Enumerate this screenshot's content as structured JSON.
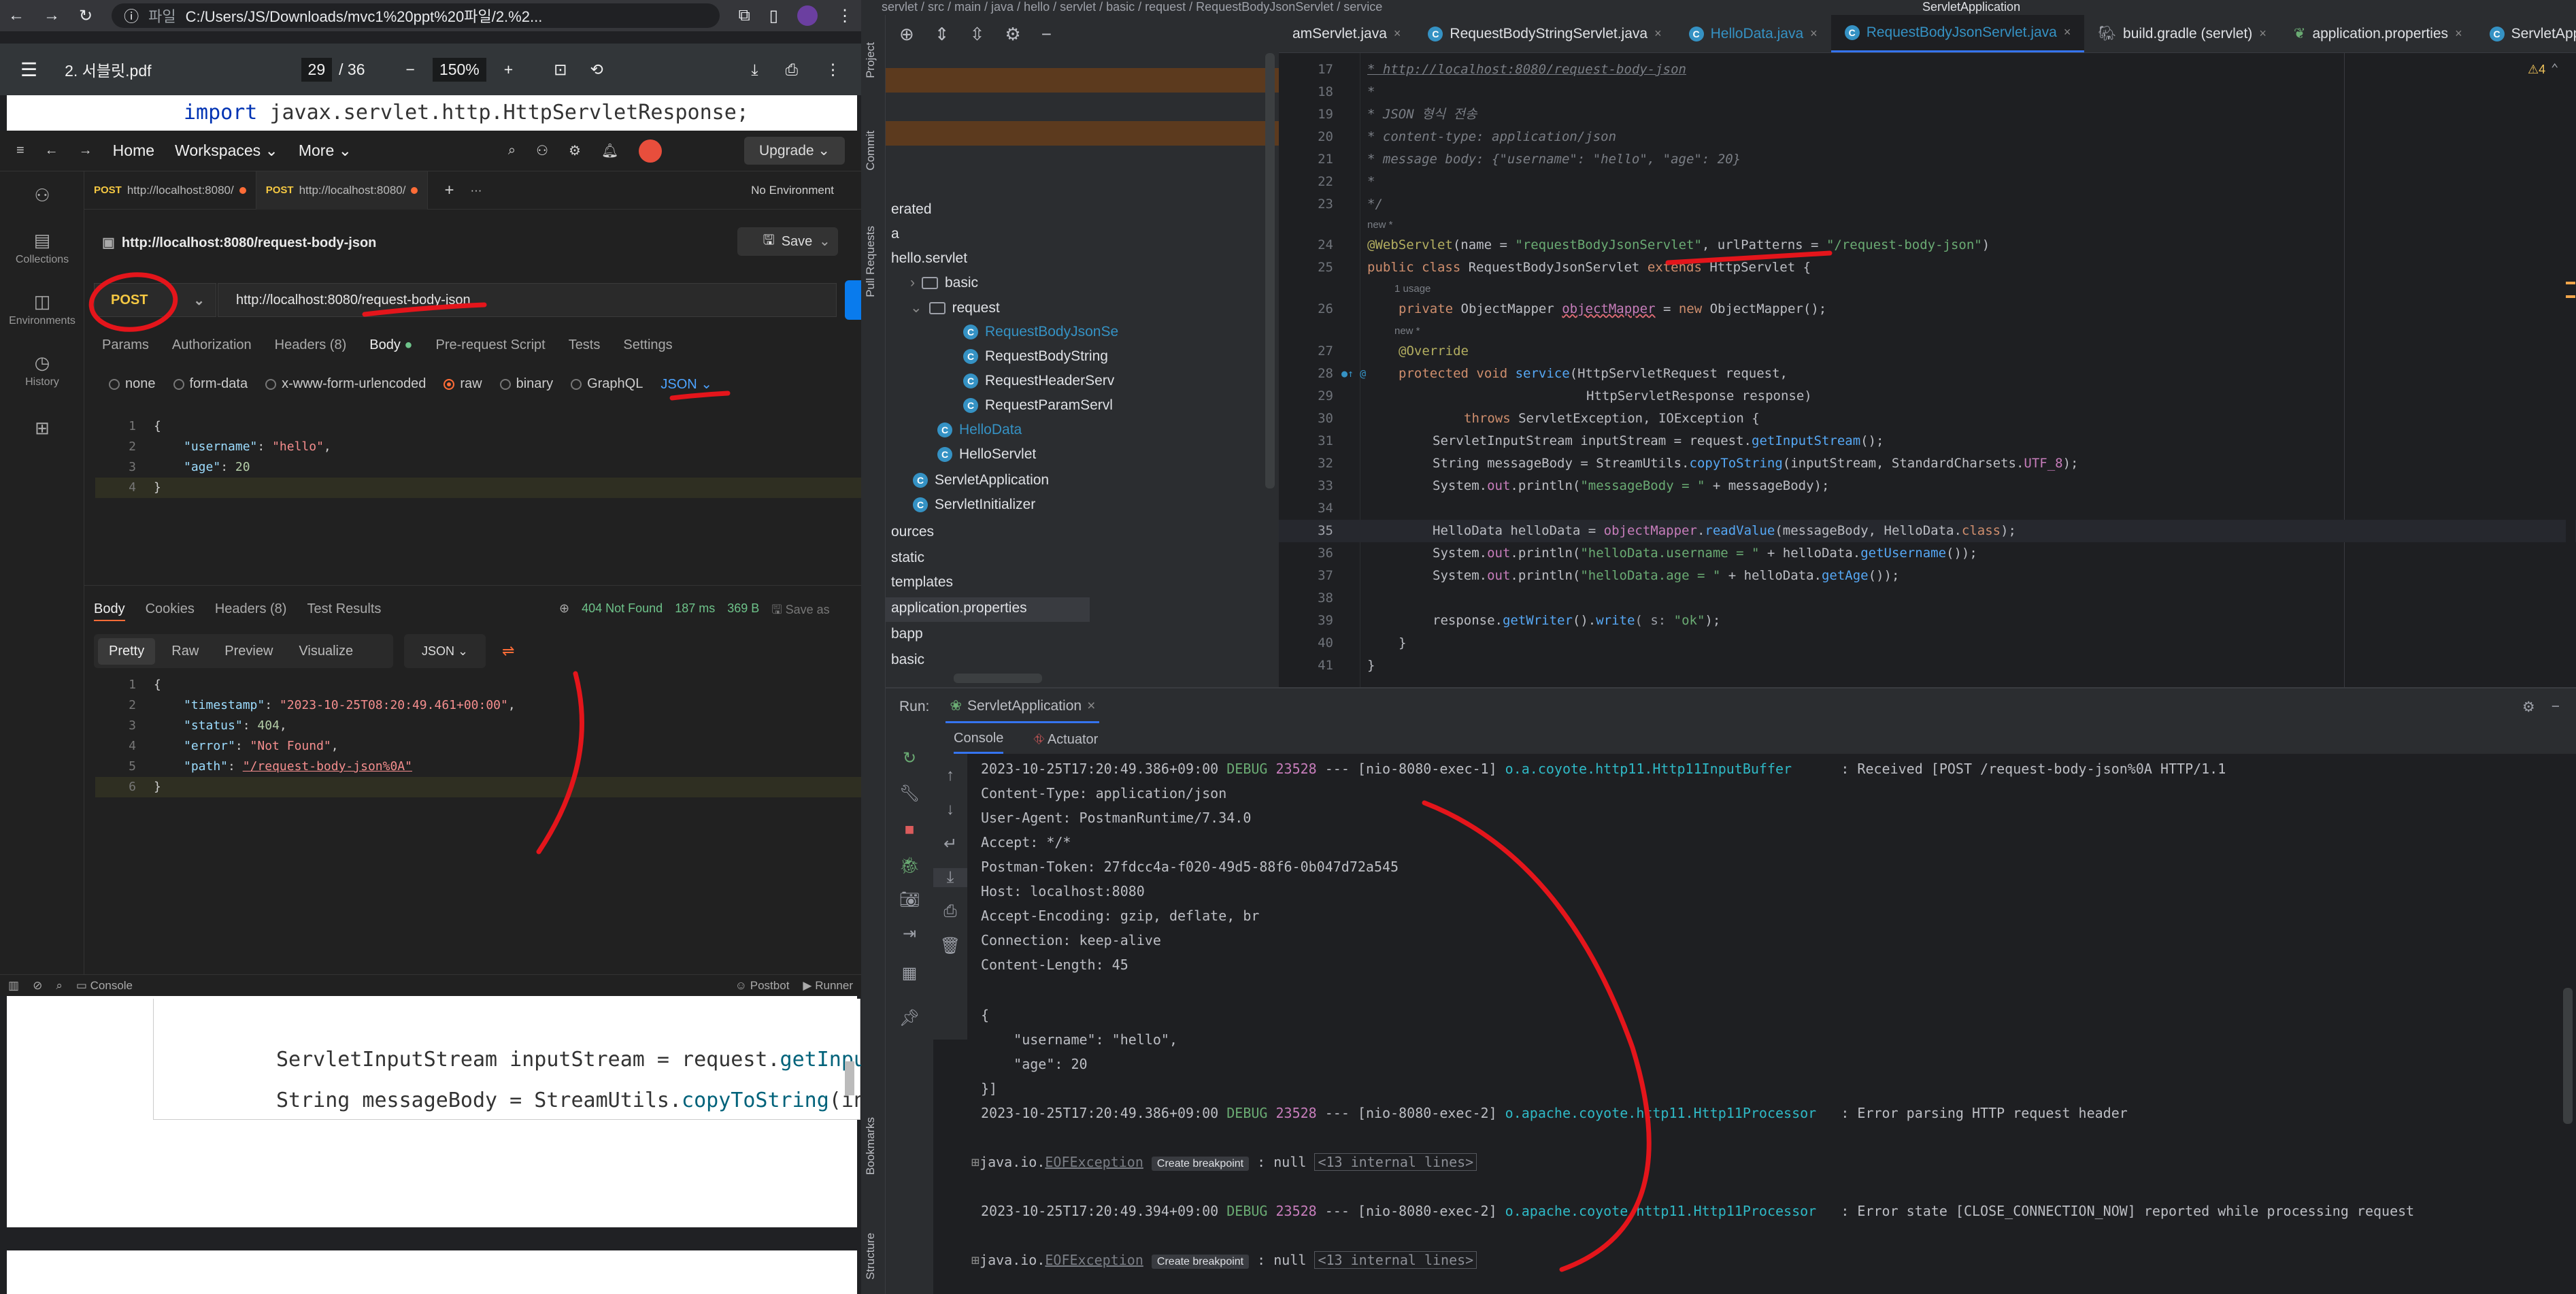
{
  "browser": {
    "address_prefix": "파일",
    "address": "C:/Users/JS/Downloads/mvc1%20ppt%20파일/2.%2..."
  },
  "pdf": {
    "filename": "2. 서블릿.pdf",
    "page_current": "29",
    "page_total": "/ 36",
    "zoom": "150%",
    "top_code_keyword": "import",
    "top_code_rest": " javax.servlet.http.HttpServletResponse;",
    "lower_line1_pre": "ServletInputStream inputStream = request.",
    "lower_line1_fn": "getInput",
    "lower_line2_pre": "String messageBody = StreamUtils.",
    "lower_line2_fn": "copyToString",
    "lower_line2_post": "(inp"
  },
  "postman": {
    "nav": {
      "home": "Home",
      "workspaces": "Workspaces",
      "more": "More",
      "upgrade": "Upgrade"
    },
    "sidebar": [
      {
        "icon": "person-icon",
        "label": ""
      },
      {
        "icon": "collections-icon",
        "label": "Collections"
      },
      {
        "icon": "environments-icon",
        "label": "Environments"
      },
      {
        "icon": "history-icon",
        "label": "History"
      },
      {
        "icon": "apps-icon",
        "label": ""
      }
    ],
    "tabs": [
      {
        "method": "POST",
        "url": "http://localhost:8080/"
      },
      {
        "method": "POST",
        "url": "http://localhost:8080/"
      }
    ],
    "environment": "No Environment",
    "request_title": "http://localhost:8080/request-body-json",
    "save_label": "Save",
    "method": "POST",
    "url": "http://localhost:8080/request-body-json",
    "req_subtabs": [
      "Params",
      "Authorization",
      "Headers (8)",
      "Body",
      "Pre-request Script",
      "Tests",
      "Settings"
    ],
    "body_types": [
      "none",
      "form-data",
      "x-www-form-urlencoded",
      "raw",
      "binary",
      "GraphQL"
    ],
    "body_format": "JSON",
    "request_body": [
      {
        "n": "1",
        "text": "{"
      },
      {
        "n": "2",
        "key": "\"username\"",
        "val": "\"hello\"",
        "tail": ","
      },
      {
        "n": "3",
        "key": "\"age\"",
        "num": "20"
      },
      {
        "n": "4",
        "text": "}"
      }
    ],
    "resp_tabs": [
      "Body",
      "Cookies",
      "Headers (8)",
      "Test Results"
    ],
    "resp_status": "404 Not Found",
    "resp_time": "187 ms",
    "resp_size": "369 B",
    "resp_save": "Save as",
    "resp_views": [
      "Pretty",
      "Raw",
      "Preview",
      "Visualize"
    ],
    "resp_format": "JSON",
    "response_body": [
      {
        "n": "1",
        "text": "{"
      },
      {
        "n": "2",
        "key": "\"timestamp\"",
        "val": "\"2023-10-25T08:20:49.461+00:00\"",
        "tail": ","
      },
      {
        "n": "3",
        "key": "\"status\"",
        "num": "404",
        "tail": ","
      },
      {
        "n": "4",
        "key": "\"error\"",
        "val": "\"Not Found\"",
        "tail": ","
      },
      {
        "n": "5",
        "key": "\"path\"",
        "val": "\"/request-body-json%0A\""
      },
      {
        "n": "6",
        "text": "}"
      }
    ],
    "footer": {
      "console": "Console",
      "postbot": "Postbot",
      "runner": "Runner"
    }
  },
  "ide": {
    "breadcrumb": "servlet  /  src  /  main  /  java  /  hello  /  servlet  /  basic  /  request  /  RequestBodyJsonServlet  /  service",
    "run_config": "ServletApplication",
    "side_labels": [
      "Project",
      "Commit",
      "Pull Requests",
      "Bookmarks",
      "Structure"
    ],
    "tree": [
      {
        "text": "erated",
        "kind": "text"
      },
      {
        "text": "a",
        "kind": "text"
      },
      {
        "text": "hello.servlet",
        "kind": "text"
      },
      {
        "text": "basic",
        "kind": "folder"
      },
      {
        "text": "request",
        "kind": "folder"
      },
      {
        "text": "RequestBodyJsonSe",
        "kind": "class",
        "selected": true
      },
      {
        "text": "RequestBodyString",
        "kind": "class"
      },
      {
        "text": "RequestHeaderServ",
        "kind": "class"
      },
      {
        "text": "RequestParamServl",
        "kind": "class"
      },
      {
        "text": "HelloData",
        "kind": "class"
      },
      {
        "text": "HelloServlet",
        "kind": "class"
      },
      {
        "text": "ServletApplication",
        "kind": "class"
      },
      {
        "text": "ServletInitializer",
        "kind": "class"
      },
      {
        "text": "ources",
        "kind": "text"
      },
      {
        "text": "static",
        "kind": "text"
      },
      {
        "text": "templates",
        "kind": "text"
      },
      {
        "text": "application.properties",
        "kind": "text",
        "selected": true
      },
      {
        "text": "bapp",
        "kind": "text"
      },
      {
        "text": "basic",
        "kind": "text"
      }
    ],
    "editor_tabs": [
      {
        "label": "amServlet.java",
        "active": false
      },
      {
        "label": "RequestBodyStringServlet.java",
        "active": false
      },
      {
        "label": "HelloData.java",
        "active": false
      },
      {
        "label": "RequestBodyJsonServlet.java",
        "active": true
      },
      {
        "label": "build.gradle (servlet)",
        "active": false
      },
      {
        "label": "application.properties",
        "active": false
      },
      {
        "label": "ServletApplication.java",
        "active": false
      }
    ],
    "warnings": "4",
    "code": {
      "l17": "17",
      "c17": "* http://localhost:8080/request-body-json",
      "l18": "18",
      "c18": "*",
      "l19": "19",
      "c19": "* JSON 형식 전송",
      "l20": "20",
      "c20": "* content-type: application/json",
      "l21": "21",
      "c21": "* message body: {\"username\": \"hello\", \"age\": 20}",
      "l22": "22",
      "c22": "*",
      "l23": "23",
      "c23": "*/",
      "hint_new1": "new *",
      "l24": "24",
      "c24_ann": "@WebServlet",
      "c24_a": "(name = ",
      "c24_s1": "\"requestBodyJsonServlet\"",
      "c24_b": ", urlPatterns = ",
      "c24_s2": "\"/request-body-json\"",
      "c24_c": ")",
      "l25": "25",
      "c25_kw": "public class ",
      "c25_a": "RequestBodyJsonServlet ",
      "c25_kw2": "extends ",
      "c25_b": "HttpServlet {",
      "hint_usage": "1 usage",
      "l26": "26",
      "c26_kw": "private ",
      "c26_a": "ObjectMapper ",
      "c26_f": "objectMapper",
      "c26_b": " = ",
      "c26_kw2": "new ",
      "c26_c": "ObjectMapper();",
      "hint_new2": "new *",
      "l27": "27",
      "c27": "@Override",
      "l28": "28",
      "c28_kw": "protected void ",
      "c28_m": "service",
      "c28_a": "(HttpServletRequest request,",
      "l29": "29",
      "c29": "HttpServletResponse response)",
      "l30": "30",
      "c30_kw": "throws ",
      "c30_a": "ServletException, IOException {",
      "l31": "31",
      "c31_a": "ServletInputStream inputStream = request.",
      "c31_m": "getInputStream",
      "c31_b": "();",
      "l32": "32",
      "c32_a": "String messageBody = StreamUtils.",
      "c32_m": "copyToString",
      "c32_b": "(inputStream, StandardCharsets.",
      "c32_f": "UTF_8",
      "c32_c": ");",
      "l33": "33",
      "c33_a": "System.",
      "c33_f": "out",
      "c33_b": ".println(",
      "c33_s": "\"messageBody = \"",
      "c33_c": " + messageBody);",
      "l34": "34",
      "l35": "35",
      "c35_a": "HelloData helloData = ",
      "c35_f": "objectMapper",
      "c35_b": ".",
      "c35_m": "readValue",
      "c35_c": "(messageBody, HelloData.",
      "c35_kw": "class",
      "c35_d": ");",
      "l36": "36",
      "c36_a": "System.",
      "c36_f": "out",
      "c36_b": ".println(",
      "c36_s": "\"helloData.username = \"",
      "c36_c": " + helloData.",
      "c36_m": "getUsername",
      "c36_d": "());",
      "l37": "37",
      "c37_a": "System.",
      "c37_f": "out",
      "c37_b": ".println(",
      "c37_s": "\"helloData.age = \"",
      "c37_c": " + helloData.",
      "c37_m": "getAge",
      "c37_d": "());",
      "l38": "38",
      "l39": "39",
      "c39_a": "response.",
      "c39_m": "getWriter",
      "c39_b": "().",
      "c39_m2": "write",
      "c39_c": "( s: ",
      "c39_s": "\"ok\"",
      "c39_d": ");",
      "l40": "40",
      "c40": "}",
      "l41": "41",
      "c41": "}"
    },
    "run": {
      "label": "Run:",
      "app": "ServletApplication",
      "console_tab": "Console",
      "actuator_tab": "Actuator",
      "log": {
        "l1_ts": "2023-10-25T17:20:49.386+09:00 ",
        "l1_lvl": "DEBUG ",
        "l1_pid": "23528",
        "l1_mid": " --- [nio-8080-exec-1] ",
        "l1_cls": "o.a.coyote.http11.Http11InputBuffer",
        "l1_msg": "      : Received [POST /request-body-json%0A HTTP/1.1",
        "l2": "Content-Type: application/json",
        "l3": "User-Agent: PostmanRuntime/7.34.0",
        "l4": "Accept: */*",
        "l5": "Postman-Token: 27fdcc4a-f020-49d5-88f6-0b047d72a545",
        "l6": "Host: localhost:8080",
        "l7": "Accept-Encoding: gzip, deflate, br",
        "l8": "Connection: keep-alive",
        "l9": "Content-Length: 45",
        "l10": "{",
        "l11": "    \"username\": \"hello\",",
        "l12": "    \"age\": 20",
        "l13": "}]",
        "l14_ts": "2023-10-25T17:20:49.386+09:00 ",
        "l14_lvl": "DEBUG ",
        "l14_pid": "23528",
        "l14_mid": " --- [nio-8080-exec-2] ",
        "l14_cls": "o.apache.coyote.http11.Http11Processor",
        "l14_msg": "   : Error parsing HTTP request header",
        "l15_pre": "java.io.",
        "l15_exc": "EOFException",
        "l15_bp": "Create breakpoint",
        "l15_post": " : null ",
        "l15_lines": "<13 internal lines>",
        "l16_ts": "2023-10-25T17:20:49.394+09:00 ",
        "l16_lvl": "DEBUG ",
        "l16_pid": "23528",
        "l16_mid": " --- [nio-8080-exec-2] ",
        "l16_cls": "o.apache.coyote.http11.Http11Processor",
        "l16_msg": "   : Error state [CLOSE_CONNECTION_NOW] reported while processing request",
        "l17_pre": "java.io.",
        "l17_exc": "EOFException",
        "l17_bp": "Create breakpoint",
        "l17_post": " : null ",
        "l17_lines": "<13 internal lines>"
      }
    }
  },
  "colors": {
    "postman_orange": "#ff6c37",
    "annotation_red": "#e4151b",
    "ide_accent": "#3574f0"
  }
}
